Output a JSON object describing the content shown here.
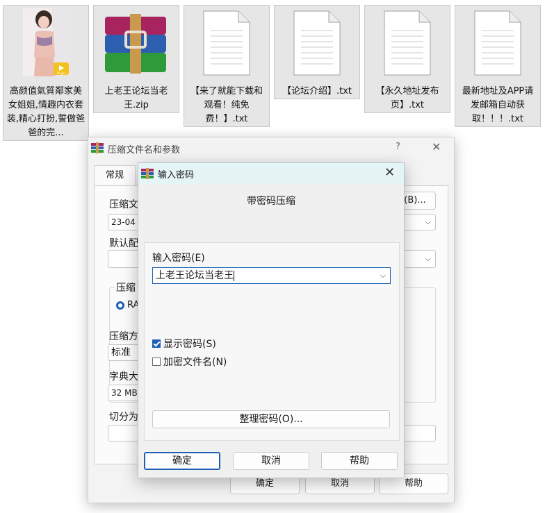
{
  "files": [
    {
      "label": "高颜值氣質鄰家美女姐姐,情趣内衣套装,精心打扮,誓做爸爸的完...",
      "badge": "Player"
    },
    {
      "label": "上老王论坛当老王.zip"
    },
    {
      "label": "【来了就能下载和观看！纯免费！】.txt"
    },
    {
      "label": "【论坛介绍】.txt"
    },
    {
      "label": "【永久地址发布页】.txt"
    },
    {
      "label": "最新地址及APP请发邮箱自动获取！！！.txt"
    }
  ],
  "back_dialog": {
    "title": "压缩文件名和参数",
    "help_icon": "?",
    "close_icon": "✕",
    "tab_general": "常规",
    "archive_name_label": "压缩文",
    "archive_name_value": "23-04",
    "browse_button": "(B)...",
    "default_profile_label": "默认配",
    "format_group_label": "压缩",
    "format_option": "RA",
    "method_label": "压缩方",
    "method_value": "标准",
    "dict_label": "字典大",
    "dict_value": "32 MB",
    "split_label": "切分为",
    "ok": "确定",
    "cancel": "取消",
    "help": "帮助"
  },
  "password_dialog": {
    "title": "输入密码",
    "close_icon": "✕",
    "heading": "带密码压缩",
    "password_label": "输入密码(E)",
    "password_value": "上老王论坛当老王",
    "show_password_label": "显示密码(S)",
    "show_password_checked": true,
    "encrypt_names_label": "加密文件名(N)",
    "encrypt_names_checked": false,
    "manage_button": "整理密码(O)...",
    "ok": "确定",
    "cancel": "取消",
    "help": "帮助"
  },
  "colors": {
    "accent": "#1e5fb4",
    "titlebar": "#e5f4f5"
  }
}
